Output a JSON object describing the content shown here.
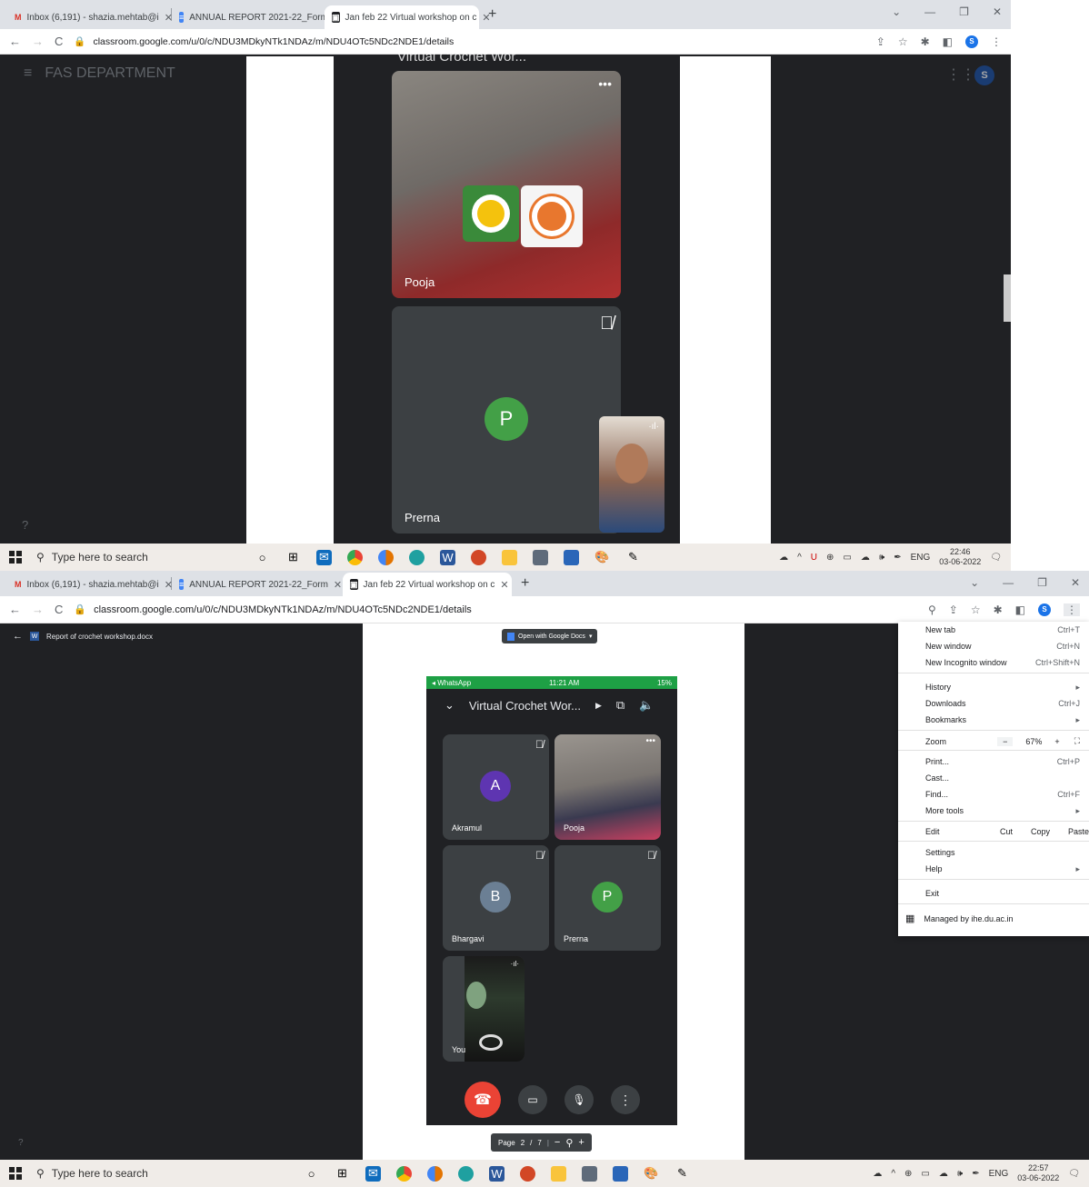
{
  "shot1": {
    "tabs": [
      {
        "label": "Inbox (6,191) - shazia.mehtab@i",
        "icon": "gmail-icon"
      },
      {
        "label": "ANNUAL REPORT 2021-22_Form",
        "icon": "docs-icon"
      },
      {
        "label": "Jan feb 22 Virtual workshop on c",
        "icon": "photo-icon"
      }
    ],
    "url": "classroom.google.com/u/0/c/NDU3MDkyNTk1NDAz/m/NDU4OTc5NDc2NDE1/details",
    "classroom_title": "FAS DEPARTMENT",
    "phone_header": "Virtual Crochet Wor...",
    "participants": [
      {
        "name": "Pooja"
      },
      {
        "name": "Prerna",
        "initial": "P"
      }
    ],
    "taskbar": {
      "search_placeholder": "Type here to search",
      "lang": "ENG",
      "time": "22:46",
      "date": "03-06-2022"
    }
  },
  "shot2": {
    "tabs": [
      {
        "label": "Inbox (6,191) - shazia.mehtab@i",
        "icon": "gmail-icon"
      },
      {
        "label": "ANNUAL REPORT 2021-22_Form",
        "icon": "docs-icon"
      },
      {
        "label": "Jan feb 22 Virtual workshop on c",
        "icon": "photo-icon"
      }
    ],
    "url": "classroom.google.com/u/0/c/NDU3MDkyNTk1NDAz/m/NDU4OTc5NDc2NDE1/details",
    "doc_title": "Report of crochet workshop.docx",
    "open_with": "Open with Google Docs",
    "status_bar": {
      "left": "◂ WhatsApp",
      "time": "11:21 AM",
      "battery": "15%"
    },
    "meeting_title": "Virtual Crochet Wor...",
    "participants": [
      {
        "name": "Akramul",
        "initial": "A",
        "color": "#5e35b1"
      },
      {
        "name": "Pooja"
      },
      {
        "name": "Bhargavi",
        "initial": "B",
        "color": "#6b7f94"
      },
      {
        "name": "Prerna",
        "initial": "P",
        "color": "#43a047"
      },
      {
        "name": "You"
      }
    ],
    "pager": {
      "label": "Page",
      "current": "2",
      "sep": "/",
      "total": "7"
    },
    "menu": {
      "items": [
        {
          "label": "New tab",
          "key": "Ctrl+T"
        },
        {
          "label": "New window",
          "key": "Ctrl+N"
        },
        {
          "label": "New Incognito window",
          "key": "Ctrl+Shift+N"
        },
        {
          "label": "History",
          "key": "▸"
        },
        {
          "label": "Downloads",
          "key": "Ctrl+J"
        },
        {
          "label": "Bookmarks",
          "key": "▸"
        },
        {
          "label": "Print...",
          "key": "Ctrl+P"
        },
        {
          "label": "Cast...",
          "key": ""
        },
        {
          "label": "Find...",
          "key": "Ctrl+F"
        },
        {
          "label": "More tools",
          "key": "▸"
        },
        {
          "label": "Settings",
          "key": ""
        },
        {
          "label": "Help",
          "key": "▸"
        },
        {
          "label": "Exit",
          "key": ""
        }
      ],
      "zoom": {
        "label": "Zoom",
        "minus": "−",
        "value": "67%",
        "plus": "+"
      },
      "edit": {
        "label": "Edit",
        "cut": "Cut",
        "copy": "Copy",
        "paste": "Paste"
      },
      "managed": "Managed by ihe.du.ac.in"
    },
    "taskbar": {
      "search_placeholder": "Type here to search",
      "lang": "ENG",
      "time": "22:57",
      "date": "03-06-2022"
    }
  },
  "colors": {
    "end_call": "#ea4335",
    "chrome_tab_strip": "#dee1e6",
    "meet_bg": "#202124"
  }
}
